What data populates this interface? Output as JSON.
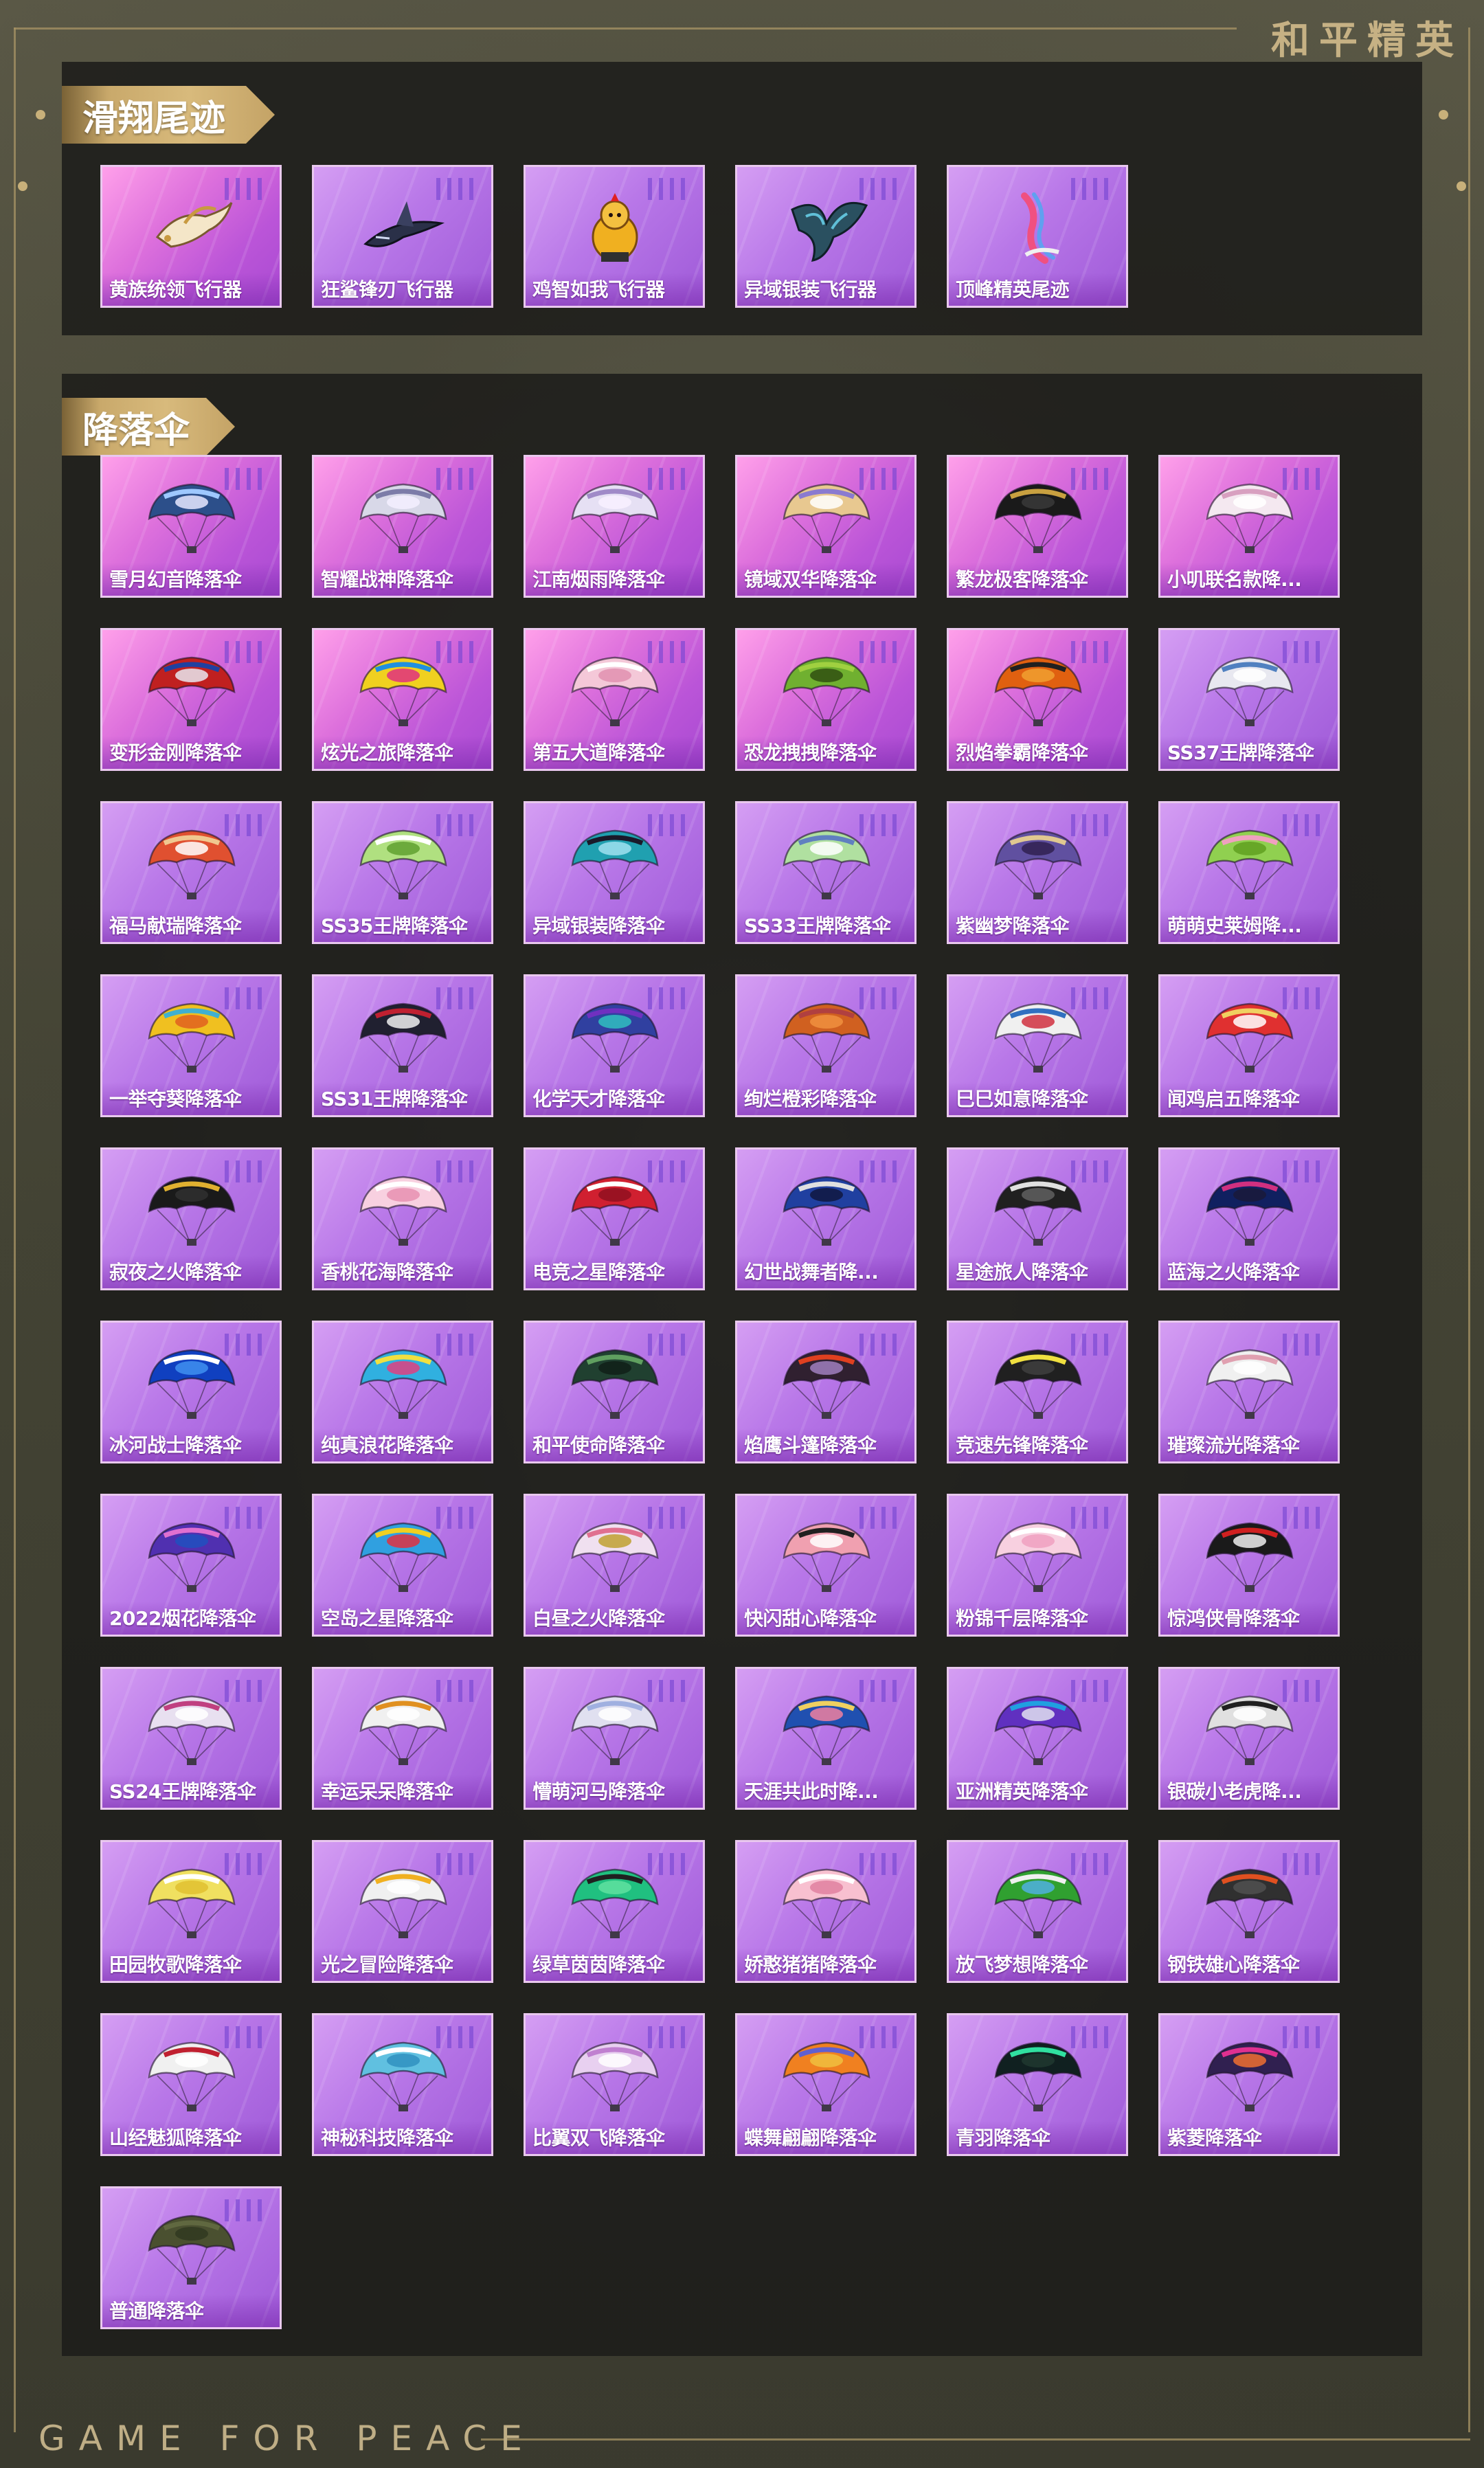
{
  "brand": {
    "cn": "和平精英",
    "en": "GAME FOR PEACE"
  },
  "sections": {
    "glide": {
      "title": "滑翔尾迹",
      "items": [
        {
          "label": "黄族统领飞行器",
          "icon": "gold-dragon-glider-icon",
          "bg": "pink"
        },
        {
          "label": "狂鲨锋刃飞行器",
          "icon": "shark-glider-icon",
          "bg": "purple"
        },
        {
          "label": "鸡智如我飞行器",
          "icon": "chicken-glider-icon",
          "bg": "purple"
        },
        {
          "label": "异域银装飞行器",
          "icon": "alien-glider-icon",
          "bg": "purple"
        },
        {
          "label": "顶峰精英尾迹",
          "icon": "trail-icon",
          "bg": "purple"
        }
      ]
    },
    "parachute": {
      "title": "降落伞",
      "items": [
        {
          "label": "雪月幻音降落伞",
          "colors": [
            "#2c4f8a",
            "#9ec8ff",
            "#e8e8ff"
          ],
          "bg": "pink"
        },
        {
          "label": "智耀战神降落伞",
          "colors": [
            "#d8d8e8",
            "#7c7ca8",
            "#f4f0ff"
          ],
          "bg": "pink"
        },
        {
          "label": "江南烟雨降落伞",
          "colors": [
            "#e6e0f4",
            "#a08ac8",
            "#f8f0ff"
          ],
          "bg": "pink"
        },
        {
          "label": "镜域双华降落伞",
          "colors": [
            "#e8c890",
            "#8a7ad0",
            "#ffffff"
          ],
          "bg": "pink"
        },
        {
          "label": "繁龙极客降落伞",
          "colors": [
            "#1a1a1a",
            "#c8a040",
            "#3a3a3a"
          ],
          "bg": "pink"
        },
        {
          "label": "小叽联名款降...",
          "colors": [
            "#f4e8f0",
            "#d8a0c0",
            "#ffffff"
          ],
          "bg": "pink"
        },
        {
          "label": "变形金刚降落伞",
          "colors": [
            "#c02020",
            "#2040a0",
            "#e8e8f0"
          ],
          "bg": "pink"
        },
        {
          "label": "炫光之旅降落伞",
          "colors": [
            "#f0d020",
            "#2090e0",
            "#e03080"
          ],
          "bg": "pink"
        },
        {
          "label": "第五大道降落伞",
          "colors": [
            "#f4c8d8",
            "#ffffff",
            "#e090b0"
          ],
          "bg": "pink"
        },
        {
          "label": "恐龙拽拽降落伞",
          "colors": [
            "#70b030",
            "#a0d040",
            "#305010"
          ],
          "bg": "pink"
        },
        {
          "label": "烈焰拳霸降落伞",
          "colors": [
            "#e06010",
            "#202020",
            "#f0a030"
          ],
          "bg": "pink"
        },
        {
          "label": "SS37王牌降落伞",
          "colors": [
            "#e8e8f0",
            "#5080c0",
            "#ffffff"
          ],
          "bg": "purple"
        },
        {
          "label": "福马献瑞降落伞",
          "colors": [
            "#e05030",
            "#f0c890",
            "#ffffff"
          ],
          "bg": "purple"
        },
        {
          "label": "SS35王牌降落伞",
          "colors": [
            "#b0e080",
            "#ffffff",
            "#60a030"
          ],
          "bg": "purple"
        },
        {
          "label": "异域银装降落伞",
          "colors": [
            "#20a0b0",
            "#1a1a2a",
            "#a0e0f0"
          ],
          "bg": "purple"
        },
        {
          "label": "SS33王牌降落伞",
          "colors": [
            "#b0e0a0",
            "#6080c0",
            "#ffffff"
          ],
          "bg": "purple"
        },
        {
          "label": "紫幽梦降落伞",
          "colors": [
            "#6050a0",
            "#e0c890",
            "#302050"
          ],
          "bg": "purple"
        },
        {
          "label": "萌萌史莱姆降...",
          "colors": [
            "#90d050",
            "#f0a0c0",
            "#60a020"
          ],
          "bg": "purple"
        },
        {
          "label": "一举夺葵降落伞",
          "colors": [
            "#f0c020",
            "#40b0d0",
            "#e06020"
          ],
          "bg": "purple"
        },
        {
          "label": "SS31王牌降落伞",
          "colors": [
            "#202030",
            "#c02030",
            "#f0f0f0"
          ],
          "bg": "purple"
        },
        {
          "label": "化学天才降落伞",
          "colors": [
            "#3040a0",
            "#7030c0",
            "#30c0c0"
          ],
          "bg": "purple"
        },
        {
          "label": "绚烂橙彩降落伞",
          "colors": [
            "#d06020",
            "#b04040",
            "#f09040"
          ],
          "bg": "purple"
        },
        {
          "label": "巳巳如意降落伞",
          "colors": [
            "#f0f0f0",
            "#3070c0",
            "#d03040"
          ],
          "bg": "purple"
        },
        {
          "label": "闻鸡启五降落伞",
          "colors": [
            "#e03030",
            "#f0d060",
            "#ffffff"
          ],
          "bg": "purple"
        },
        {
          "label": "寂夜之火降落伞",
          "colors": [
            "#1a1a1a",
            "#e0b030",
            "#303030"
          ],
          "bg": "purple"
        },
        {
          "label": "香桃花海降落伞",
          "colors": [
            "#f8d0e0",
            "#ffffff",
            "#e890b0"
          ],
          "bg": "purple"
        },
        {
          "label": "电竞之星降落伞",
          "colors": [
            "#d02030",
            "#ffffff",
            "#901020"
          ],
          "bg": "purple"
        },
        {
          "label": "幻世战舞者降...",
          "colors": [
            "#2040a0",
            "#e0e0e0",
            "#101840"
          ],
          "bg": "purple"
        },
        {
          "label": "星途旅人降落伞",
          "colors": [
            "#202020",
            "#e0e0e0",
            "#606060"
          ],
          "bg": "purple"
        },
        {
          "label": "蓝海之火降落伞",
          "colors": [
            "#102060",
            "#d03080",
            "#1a1a3a"
          ],
          "bg": "purple"
        },
        {
          "label": "冰河战士降落伞",
          "colors": [
            "#1040c0",
            "#ffffff",
            "#4090f0"
          ],
          "bg": "purple"
        },
        {
          "label": "纯真浪花降落伞",
          "colors": [
            "#30b0e0",
            "#f0e040",
            "#e04080"
          ],
          "bg": "purple"
        },
        {
          "label": "和平使命降落伞",
          "colors": [
            "#204030",
            "#60a060",
            "#102018"
          ],
          "bg": "purple"
        },
        {
          "label": "焰鹰斗篷降落伞",
          "colors": [
            "#302030",
            "#e04020",
            "#a080c0"
          ],
          "bg": "purple"
        },
        {
          "label": "竞速先锋降落伞",
          "colors": [
            "#202020",
            "#f0e040",
            "#404040"
          ],
          "bg": "purple"
        },
        {
          "label": "璀璨流光降落伞",
          "colors": [
            "#f0f0f0",
            "#e0a0b0",
            "#ffffff"
          ],
          "bg": "purple"
        },
        {
          "label": "2022烟花降落伞",
          "colors": [
            "#5030b0",
            "#e070d0",
            "#2050c0"
          ],
          "bg": "purple"
        },
        {
          "label": "空岛之星降落伞",
          "colors": [
            "#30a0e0",
            "#f0d020",
            "#e03040"
          ],
          "bg": "purple"
        },
        {
          "label": "白昼之火降落伞",
          "colors": [
            "#f0e0f0",
            "#e07090",
            "#c0a030"
          ],
          "bg": "purple"
        },
        {
          "label": "快闪甜心降落伞",
          "colors": [
            "#f0a0b0",
            "#202020",
            "#ffffff"
          ],
          "bg": "purple"
        },
        {
          "label": "粉锦千层降落伞",
          "colors": [
            "#f8d0e0",
            "#ffffff",
            "#f0a0c0"
          ],
          "bg": "purple"
        },
        {
          "label": "惊鸿侠骨降落伞",
          "colors": [
            "#1a1a1a",
            "#d02020",
            "#f0f0f0"
          ],
          "bg": "purple"
        },
        {
          "label": "SS24王牌降落伞",
          "colors": [
            "#e8e0f0",
            "#c04080",
            "#ffffff"
          ],
          "bg": "purple"
        },
        {
          "label": "幸运呆呆降落伞",
          "colors": [
            "#f0f0f0",
            "#e09020",
            "#ffffff"
          ],
          "bg": "purple"
        },
        {
          "label": "懵萌河马降落伞",
          "colors": [
            "#e0e0f0",
            "#a0b0e0",
            "#ffffff"
          ],
          "bg": "purple"
        },
        {
          "label": "天涯共此时降...",
          "colors": [
            "#2050b0",
            "#f0d060",
            "#f080a0"
          ],
          "bg": "purple"
        },
        {
          "label": "亚洲精英降落伞",
          "colors": [
            "#6030c0",
            "#20a0e0",
            "#e0e0f0"
          ],
          "bg": "purple"
        },
        {
          "label": "银碳小老虎降...",
          "colors": [
            "#e0e0e0",
            "#202020",
            "#ffffff"
          ],
          "bg": "purple"
        },
        {
          "label": "田园牧歌降落伞",
          "colors": [
            "#f0e060",
            "#ffffff",
            "#e0c030"
          ],
          "bg": "purple"
        },
        {
          "label": "光之冒险降落伞",
          "colors": [
            "#f0f0f0",
            "#f0b020",
            "#ffffff"
          ],
          "bg": "purple"
        },
        {
          "label": "绿草茵茵降落伞",
          "colors": [
            "#20c080",
            "#202020",
            "#60e0a0"
          ],
          "bg": "purple"
        },
        {
          "label": "娇憨猪猪降落伞",
          "colors": [
            "#f8c0d0",
            "#ffffff",
            "#e080a0"
          ],
          "bg": "purple"
        },
        {
          "label": "放飞梦想降落伞",
          "colors": [
            "#30a030",
            "#f0f0f0",
            "#50b0e0"
          ],
          "bg": "purple"
        },
        {
          "label": "钢铁雄心降落伞",
          "colors": [
            "#303030",
            "#e05020",
            "#505050"
          ],
          "bg": "purple"
        },
        {
          "label": "山经魅狐降落伞",
          "colors": [
            "#f0f0f0",
            "#c02030",
            "#ffffff"
          ],
          "bg": "purple"
        },
        {
          "label": "神秘科技降落伞",
          "colors": [
            "#60c0e0",
            "#ffffff",
            "#3090c0"
          ],
          "bg": "purple"
        },
        {
          "label": "比翼双飞降落伞",
          "colors": [
            "#e8d0f0",
            "#c080d0",
            "#ffffff"
          ],
          "bg": "purple"
        },
        {
          "label": "蝶舞翩翩降落伞",
          "colors": [
            "#f08020",
            "#6060d0",
            "#f0c040"
          ],
          "bg": "purple"
        },
        {
          "label": "青羽降落伞",
          "colors": [
            "#102020",
            "#30e0a0",
            "#203830"
          ],
          "bg": "purple"
        },
        {
          "label": "紫菱降落伞",
          "colors": [
            "#302050",
            "#e03090",
            "#f07030"
          ],
          "bg": "purple"
        },
        {
          "label": "普通降落伞",
          "colors": [
            "#4a5030",
            "#606840",
            "#303820"
          ],
          "bg": "purple"
        }
      ]
    }
  }
}
